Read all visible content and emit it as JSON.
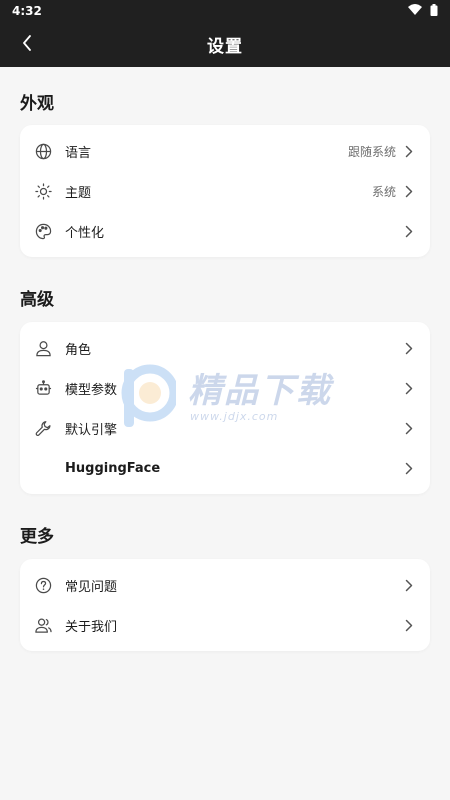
{
  "status_bar": {
    "time": "4:32"
  },
  "app_bar": {
    "title": "设置"
  },
  "sections": {
    "appearance": {
      "title": "外观",
      "items": [
        {
          "label": "语言",
          "value": "跟随系统",
          "icon": "globe-icon"
        },
        {
          "label": "主题",
          "value": "系统",
          "icon": "sun-icon"
        },
        {
          "label": "个性化",
          "value": "",
          "icon": "palette-icon"
        }
      ]
    },
    "advanced": {
      "title": "高级",
      "items": [
        {
          "label": "角色",
          "value": "",
          "icon": "person-icon"
        },
        {
          "label": "模型参数",
          "value": "",
          "icon": "robot-icon"
        },
        {
          "label": "默认引擎",
          "value": "",
          "icon": "wrench-icon"
        },
        {
          "label": "HuggingFace",
          "value": "",
          "icon": ""
        }
      ]
    },
    "more": {
      "title": "更多",
      "items": [
        {
          "label": "常见问题",
          "value": "",
          "icon": "question-icon"
        },
        {
          "label": "关于我们",
          "value": "",
          "icon": "people-icon"
        }
      ]
    }
  },
  "watermark": {
    "text": "精品下载",
    "url": "www.jdjx.com"
  },
  "colors": {
    "app_bar": "#202020",
    "background": "#f6f6f6",
    "card": "#ffffff",
    "watermark": "#6f90c8"
  }
}
